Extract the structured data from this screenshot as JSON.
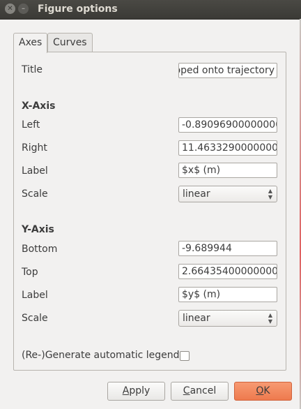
{
  "window": {
    "title": "Figure options"
  },
  "tabs": [
    {
      "label": "Axes"
    },
    {
      "label": "Curves"
    }
  ],
  "axes": {
    "title_label": "Title",
    "title_value": "pped onto trajectory",
    "x_axis": {
      "heading": "X-Axis",
      "left_label": "Left",
      "left_value": "-0.890969000000000",
      "right_label": "Right",
      "right_value": "11.46332900000000",
      "label_label": "Label",
      "label_value": "$x$ (m)",
      "scale_label": "Scale",
      "scale_value": "linear"
    },
    "y_axis": {
      "heading": "Y-Axis",
      "bottom_label": "Bottom",
      "bottom_value": "-9.689944",
      "top_label": "Top",
      "top_value": "2.664354000000001",
      "label_label": "Label",
      "label_value": "$y$ (m)",
      "scale_label": "Scale",
      "scale_value": "linear"
    },
    "legend_label": "(Re-)Generate automatic legend",
    "legend_checked": false
  },
  "buttons": {
    "apply_pre": "",
    "apply_mn": "A",
    "apply_post": "pply",
    "cancel_pre": "",
    "cancel_mn": "C",
    "cancel_post": "ancel",
    "ok_pre": "",
    "ok_mn": "O",
    "ok_post": "K"
  }
}
